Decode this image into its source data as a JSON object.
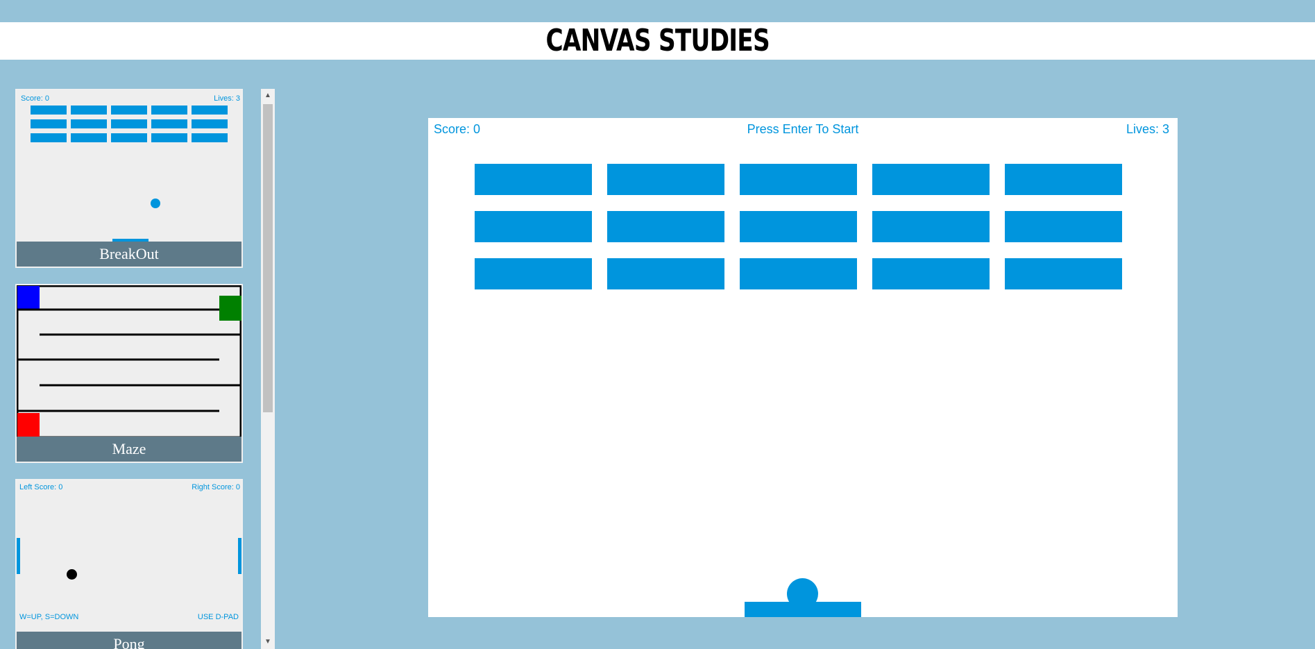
{
  "page": {
    "title": "CANVAS STUDIES"
  },
  "sidebar": {
    "cards": [
      {
        "caption": "BreakOut",
        "score": "Score: 0",
        "lives": "Lives: 3"
      },
      {
        "caption": "Maze"
      },
      {
        "caption": "Pong",
        "left_score": "Left Score: 0",
        "right_score": "Right Score: 0",
        "left_controls": "W=UP, S=DOWN",
        "right_controls": "USE D-PAD"
      }
    ]
  },
  "game": {
    "score": "Score: 0",
    "status": "Press Enter To Start",
    "lives": "Lives: 3",
    "brick_rows": 3,
    "brick_cols": 5
  },
  "colors": {
    "background": "#95c2d8",
    "accent": "#0095dd",
    "caption_bar": "#5e7a89",
    "maze_start": "#0000ff",
    "maze_goal": "#008000",
    "maze_enemy": "#ff0000"
  }
}
